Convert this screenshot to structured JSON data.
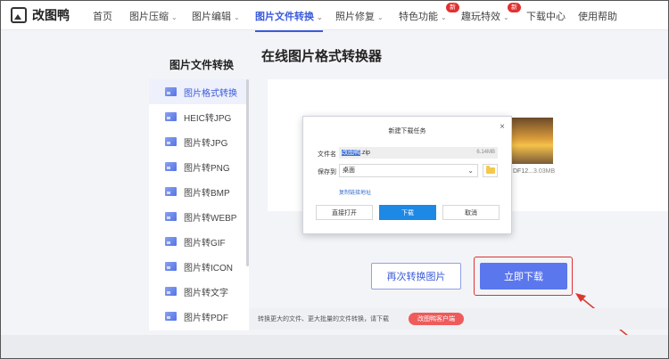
{
  "app": {
    "name": "改图鸭"
  },
  "nav": {
    "items": [
      {
        "label": "首页",
        "chevron": false,
        "badge": ""
      },
      {
        "label": "图片压缩",
        "chevron": true,
        "badge": ""
      },
      {
        "label": "图片编辑",
        "chevron": true,
        "badge": ""
      },
      {
        "label": "图片文件转换",
        "chevron": true,
        "badge": "",
        "active": true
      },
      {
        "label": "照片修复",
        "chevron": true,
        "badge": ""
      },
      {
        "label": "特色功能",
        "chevron": true,
        "badge": "新"
      },
      {
        "label": "趣玩特效",
        "chevron": true,
        "badge": "新"
      },
      {
        "label": "下载中心",
        "chevron": false,
        "badge": ""
      },
      {
        "label": "使用帮助",
        "chevron": false,
        "badge": ""
      }
    ]
  },
  "sidebar": {
    "title": "图片文件转换",
    "items": [
      {
        "label": "图片格式转换",
        "active": true
      },
      {
        "label": "HEIC转JPG"
      },
      {
        "label": "图片转JPG"
      },
      {
        "label": "图片转PNG"
      },
      {
        "label": "图片转BMP"
      },
      {
        "label": "图片转WEBP"
      },
      {
        "label": "图片转GIF"
      },
      {
        "label": "图片转ICON"
      },
      {
        "label": "图片转文字"
      },
      {
        "label": "图片转PDF"
      }
    ]
  },
  "main": {
    "title": "在线图片格式转换器",
    "thumbnail": {
      "name": "DF12...",
      "size": "3.03MB"
    },
    "reconvert_label": "再次转换图片",
    "download_now_label": "立即下载",
    "footer_text": "转换更大的文件、更大批量的文件转换，请下载",
    "footer_button": "改图鸭客户端"
  },
  "dialog": {
    "title": "新建下载任务",
    "close": "×",
    "filename_label": "文件名",
    "filename_selected": "改图鸭",
    "filename_ext": ".zip",
    "filesize": "6.14MB",
    "saveto_label": "保存到",
    "saveto_value": "桌面",
    "copy_link": "复制链接地址",
    "btn_open": "直接打开",
    "btn_download": "下载",
    "btn_cancel": "取消"
  }
}
